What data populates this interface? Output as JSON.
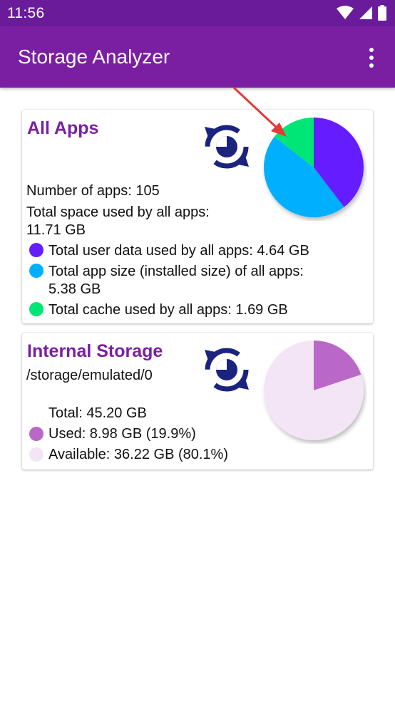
{
  "status_bar": {
    "time": "11:56"
  },
  "app_bar": {
    "title": "Storage Analyzer"
  },
  "all_apps": {
    "title": "All Apps",
    "num_apps": "Number of apps: 105",
    "total_space_label": "Total space used by all apps:",
    "total_space_value": "11.71 GB",
    "user_data": "Total user data used by all apps: 4.64 GB",
    "app_size_line1": "Total app size (installed size) of all apps:",
    "app_size_line2": "5.38 GB",
    "cache": "Total cache used by all apps: 1.69 GB",
    "pie": {
      "slices": [
        {
          "label": "user data",
          "value": 4.64,
          "color": "#651fff"
        },
        {
          "label": "app size",
          "value": 5.38,
          "color": "#00b0ff"
        },
        {
          "label": "cache",
          "value": 1.69,
          "color": "#00e676"
        }
      ]
    }
  },
  "internal_storage": {
    "title": "Internal Storage",
    "path": "/storage/emulated/0",
    "total": "Total: 45.20 GB",
    "used": "Used: 8.98 GB (19.9%)",
    "available": "Available: 36.22 GB (80.1%)",
    "pie": {
      "slices": [
        {
          "label": "used",
          "value": 8.98,
          "color": "#ba68c8"
        },
        {
          "label": "available",
          "value": 36.22,
          "color": "#f3e5f5"
        }
      ]
    }
  },
  "colors": {
    "status_bar": "#6a1b9a",
    "app_bar": "#7b1fa2",
    "title_accent": "#7b1fa2",
    "refresh_icon": "#1a237e",
    "arrow": "#e53935"
  },
  "icons": [
    "wifi-icon",
    "signal-icon",
    "battery-icon",
    "overflow-menu-icon",
    "refresh-icon"
  ]
}
